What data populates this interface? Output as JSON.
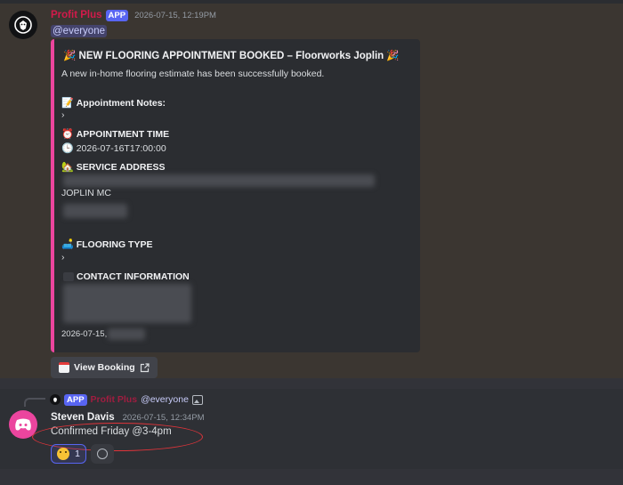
{
  "message1": {
    "author": "Profit Plus",
    "badge": "APP",
    "timestamp": "2026-07-15, 12:19PM",
    "mention": "@everyone",
    "embed": {
      "accent_color": "#eb459e",
      "title": "🎉 NEW FLOORING APPOINTMENT BOOKED – Floorworks Joplin 🎉",
      "description": "A new in-home flooring estimate has been successfully booked.",
      "fields": {
        "notes": {
          "emoji": "📝",
          "name": "Appointment Notes:",
          "value": "›"
        },
        "time": {
          "emoji": "⏰",
          "name": "APPOINTMENT TIME",
          "value_emoji": "🕒",
          "value": "2026-07-16T17:00:00"
        },
        "address": {
          "emoji": "🏡",
          "name": "SERVICE ADDRESS",
          "city": "JOPLIN MC"
        },
        "flooring": {
          "emoji": "🛋️",
          "name": "FLOORING TYPE",
          "value": "›"
        },
        "contact": {
          "emoji": "",
          "name": "CONTACT INFORMATION"
        }
      },
      "footer": "2026-07-15,"
    },
    "button": {
      "label": "View Booking",
      "icon": "calendar-icon",
      "external_icon": "external-link-icon"
    }
  },
  "message2": {
    "reply": {
      "badge": "APP",
      "author": "Profit Plus",
      "mention": "@everyone",
      "attachment_icon": "image-icon"
    },
    "author": "Steven Davis",
    "timestamp": "2026-07-15, 12:34PM",
    "content": "Confirmed Friday @3-4pm",
    "reaction": {
      "emoji": "face-emoji",
      "count": "1"
    },
    "add_reaction_icon": "add-reaction-icon"
  },
  "colors": {
    "mention_highlight": "#3b3631",
    "app_badge": "#5865f2",
    "bot_name": "#d21a4b",
    "annotation_circle": "#e0343a"
  }
}
